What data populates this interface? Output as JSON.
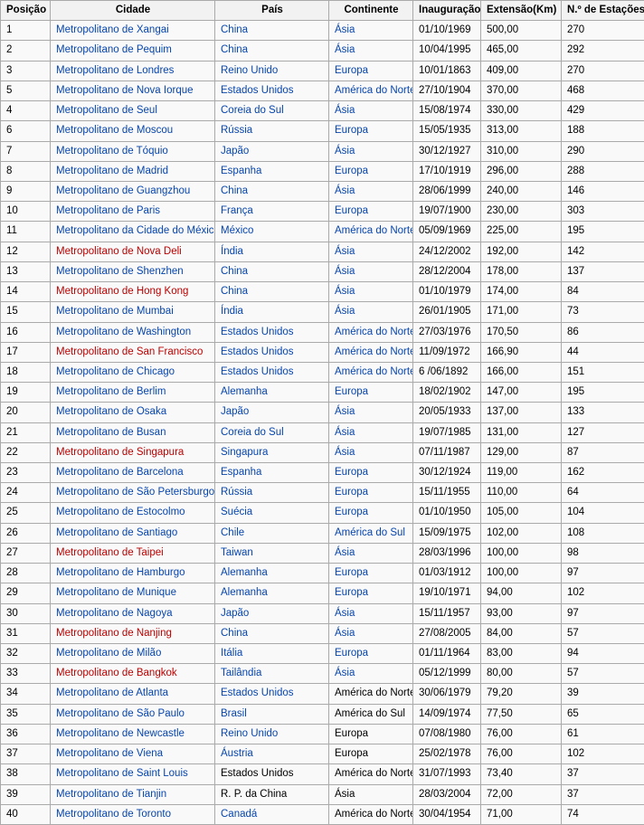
{
  "table": {
    "columns": [
      {
        "key": "posicao",
        "label": "Posição"
      },
      {
        "key": "cidade",
        "label": "Cidade"
      },
      {
        "key": "pais",
        "label": "País"
      },
      {
        "key": "continente",
        "label": "Continente"
      },
      {
        "key": "inauguracao",
        "label": "Inauguração"
      },
      {
        "key": "extensao",
        "label": "Extensão(Km)"
      },
      {
        "key": "estacoes",
        "label": "N.º de Estações"
      }
    ],
    "colors": {
      "link_blue": "#0645ad",
      "link_red": "#ba0000",
      "plain_text": "#000000",
      "header_bg": "#f2f2f2",
      "cell_bg": "#f9f9f9",
      "border": "#aaaaaa"
    },
    "rows": [
      {
        "posicao": "1",
        "cidade": "Metropolitano de Xangai",
        "cidade_style": "link-blue",
        "pais": "China",
        "pais_style": "link-blue",
        "continente": "Ásia",
        "continente_style": "link-blue",
        "inauguracao": "01/10/1969",
        "extensao": "500,00",
        "estacoes": "270"
      },
      {
        "posicao": "2",
        "cidade": "Metropolitano de Pequim",
        "cidade_style": "link-blue",
        "pais": "China",
        "pais_style": "link-blue",
        "continente": "Ásia",
        "continente_style": "link-blue",
        "inauguracao": "10/04/1995",
        "extensao": "465,00",
        "estacoes": "292"
      },
      {
        "posicao": "3",
        "cidade": "Metropolitano de Londres",
        "cidade_style": "link-blue",
        "pais": "Reino Unido",
        "pais_style": "link-blue",
        "continente": "Europa",
        "continente_style": "link-blue",
        "inauguracao": "10/01/1863",
        "extensao": "409,00",
        "estacoes": "270"
      },
      {
        "posicao": "5",
        "cidade": "Metropolitano de Nova Iorque",
        "cidade_style": "link-blue",
        "pais": "Estados Unidos",
        "pais_style": "link-blue",
        "continente": "América do Norte",
        "continente_style": "link-blue",
        "inauguracao": "27/10/1904",
        "extensao": "370,00",
        "estacoes": "468"
      },
      {
        "posicao": "4",
        "cidade": "Metropolitano de Seul",
        "cidade_style": "link-blue",
        "pais": "Coreia do Sul",
        "pais_style": "link-blue",
        "continente": "Ásia",
        "continente_style": "link-blue",
        "inauguracao": "15/08/1974",
        "extensao": "330,00",
        "estacoes": "429"
      },
      {
        "posicao": "6",
        "cidade": "Metropolitano de Moscou",
        "cidade_style": "link-blue",
        "pais": "Rússia",
        "pais_style": "link-blue",
        "continente": "Europa",
        "continente_style": "link-blue",
        "inauguracao": "15/05/1935",
        "extensao": "313,00",
        "estacoes": "188"
      },
      {
        "posicao": "7",
        "cidade": "Metropolitano de Tóquio",
        "cidade_style": "link-blue",
        "pais": "Japão",
        "pais_style": "link-blue",
        "continente": "Ásia",
        "continente_style": "link-blue",
        "inauguracao": "30/12/1927",
        "extensao": "310,00",
        "estacoes": "290"
      },
      {
        "posicao": "8",
        "cidade": "Metropolitano de Madrid",
        "cidade_style": "link-blue",
        "pais": "Espanha",
        "pais_style": "link-blue",
        "continente": "Europa",
        "continente_style": "link-blue",
        "inauguracao": "17/10/1919",
        "extensao": "296,00",
        "estacoes": "288"
      },
      {
        "posicao": "9",
        "cidade": "Metropolitano de Guangzhou",
        "cidade_style": "link-blue",
        "pais": "China",
        "pais_style": "link-blue",
        "continente": "Ásia",
        "continente_style": "link-blue",
        "inauguracao": "28/06/1999",
        "extensao": "240,00",
        "estacoes": "146"
      },
      {
        "posicao": "10",
        "cidade": "Metropolitano de Paris",
        "cidade_style": "link-blue",
        "pais": "França",
        "pais_style": "link-blue",
        "continente": "Europa",
        "continente_style": "link-blue",
        "inauguracao": "19/07/1900",
        "extensao": "230,00",
        "estacoes": "303"
      },
      {
        "posicao": "11",
        "cidade": "Metropolitano da Cidade do México",
        "cidade_style": "link-blue",
        "pais": "México",
        "pais_style": "link-blue",
        "continente": "América do Norte",
        "continente_style": "link-blue",
        "inauguracao": "05/09/1969",
        "extensao": "225,00",
        "estacoes": "195"
      },
      {
        "posicao": "12",
        "cidade": "Metropolitano de Nova Deli",
        "cidade_style": "link-red",
        "pais": "Índia",
        "pais_style": "link-blue",
        "continente": "Ásia",
        "continente_style": "link-blue",
        "inauguracao": "24/12/2002",
        "extensao": "192,00",
        "estacoes": "142"
      },
      {
        "posicao": "13",
        "cidade": "Metropolitano de Shenzhen",
        "cidade_style": "link-blue",
        "pais": "China",
        "pais_style": "link-blue",
        "continente": "Ásia",
        "continente_style": "link-blue",
        "inauguracao": "28/12/2004",
        "extensao": "178,00",
        "estacoes": "137"
      },
      {
        "posicao": "14",
        "cidade": "Metropolitano de Hong Kong",
        "cidade_style": "link-red",
        "pais": "China",
        "pais_style": "link-blue",
        "continente": "Ásia",
        "continente_style": "link-blue",
        "inauguracao": "01/10/1979",
        "extensao": "174,00",
        "estacoes": "84"
      },
      {
        "posicao": "15",
        "cidade": "Metropolitano de Mumbai",
        "cidade_style": "link-blue",
        "pais": "Índia",
        "pais_style": "link-blue",
        "continente": "Ásia",
        "continente_style": "link-blue",
        "inauguracao": "26/01/1905",
        "extensao": "171,00",
        "estacoes": "73"
      },
      {
        "posicao": "16",
        "cidade": "Metropolitano de Washington",
        "cidade_style": "link-blue",
        "pais": "Estados Unidos",
        "pais_style": "link-blue",
        "continente": "América do Norte",
        "continente_style": "link-blue",
        "inauguracao": "27/03/1976",
        "extensao": "170,50",
        "estacoes": "86"
      },
      {
        "posicao": "17",
        "cidade": "Metropolitano de San Francisco",
        "cidade_style": "link-red",
        "pais": "Estados Unidos",
        "pais_style": "link-blue",
        "continente": "América do Norte",
        "continente_style": "link-blue",
        "inauguracao": "11/09/1972",
        "extensao": "166,90",
        "estacoes": "44"
      },
      {
        "posicao": "18",
        "cidade": "Metropolitano de Chicago",
        "cidade_style": "link-blue",
        "pais": "Estados Unidos",
        "pais_style": "link-blue",
        "continente": "América do Norte",
        "continente_style": "link-blue",
        "inauguracao": "6 /06/1892",
        "extensao": "166,00",
        "estacoes": "151"
      },
      {
        "posicao": "19",
        "cidade": "Metropolitano de Berlim",
        "cidade_style": "link-blue",
        "pais": "Alemanha",
        "pais_style": "link-blue",
        "continente": "Europa",
        "continente_style": "link-blue",
        "inauguracao": "18/02/1902",
        "extensao": "147,00",
        "estacoes": "195"
      },
      {
        "posicao": "20",
        "cidade": "Metropolitano de Osaka",
        "cidade_style": "link-blue",
        "pais": "Japão",
        "pais_style": "link-blue",
        "continente": "Ásia",
        "continente_style": "link-blue",
        "inauguracao": "20/05/1933",
        "extensao": "137,00",
        "estacoes": "133"
      },
      {
        "posicao": "21",
        "cidade": "Metropolitano de Busan",
        "cidade_style": "link-blue",
        "pais": "Coreia do Sul",
        "pais_style": "link-blue",
        "continente": "Ásia",
        "continente_style": "link-blue",
        "inauguracao": "19/07/1985",
        "extensao": "131,00",
        "estacoes": "127"
      },
      {
        "posicao": "22",
        "cidade": "Metropolitano de Singapura",
        "cidade_style": "link-red",
        "pais": "Singapura",
        "pais_style": "link-blue",
        "continente": "Ásia",
        "continente_style": "link-blue",
        "inauguracao": "07/11/1987",
        "extensao": "129,00",
        "estacoes": "87"
      },
      {
        "posicao": "23",
        "cidade": "Metropolitano de Barcelona",
        "cidade_style": "link-blue",
        "pais": "Espanha",
        "pais_style": "link-blue",
        "continente": "Europa",
        "continente_style": "link-blue",
        "inauguracao": "30/12/1924",
        "extensao": "119,00",
        "estacoes": "162"
      },
      {
        "posicao": "24",
        "cidade": "Metropolitano de São Petersburgo",
        "cidade_style": "link-blue",
        "pais": "Rússia",
        "pais_style": "link-blue",
        "continente": "Europa",
        "continente_style": "link-blue",
        "inauguracao": "15/11/1955",
        "extensao": "110,00",
        "estacoes": "64"
      },
      {
        "posicao": "25",
        "cidade": "Metropolitano de Estocolmo",
        "cidade_style": "link-blue",
        "pais": "Suécia",
        "pais_style": "link-blue",
        "continente": "Europa",
        "continente_style": "link-blue",
        "inauguracao": "01/10/1950",
        "extensao": "105,00",
        "estacoes": "104"
      },
      {
        "posicao": "26",
        "cidade": "Metropolitano de Santiago",
        "cidade_style": "link-blue",
        "pais": "Chile",
        "pais_style": "link-blue",
        "continente": "América do Sul",
        "continente_style": "link-blue",
        "inauguracao": "15/09/1975",
        "extensao": "102,00",
        "estacoes": "108"
      },
      {
        "posicao": "27",
        "cidade": "Metropolitano de Taipei",
        "cidade_style": "link-red",
        "pais": "Taiwan",
        "pais_style": "link-blue",
        "continente": "Ásia",
        "continente_style": "link-blue",
        "inauguracao": "28/03/1996",
        "extensao": "100,00",
        "estacoes": "98"
      },
      {
        "posicao": "28",
        "cidade": "Metropolitano de Hamburgo",
        "cidade_style": "link-blue",
        "pais": "Alemanha",
        "pais_style": "link-blue",
        "continente": "Europa",
        "continente_style": "link-blue",
        "inauguracao": "01/03/1912",
        "extensao": "100,00",
        "estacoes": "97"
      },
      {
        "posicao": "29",
        "cidade": "Metropolitano de Munique",
        "cidade_style": "link-blue",
        "pais": "Alemanha",
        "pais_style": "link-blue",
        "continente": "Europa",
        "continente_style": "link-blue",
        "inauguracao": "19/10/1971",
        "extensao": "94,00",
        "estacoes": "102"
      },
      {
        "posicao": "30",
        "cidade": "Metropolitano de Nagoya",
        "cidade_style": "link-blue",
        "pais": "Japão",
        "pais_style": "link-blue",
        "continente": "Ásia",
        "continente_style": "link-blue",
        "inauguracao": "15/11/1957",
        "extensao": "93,00",
        "estacoes": "97"
      },
      {
        "posicao": "31",
        "cidade": "Metropolitano de Nanjing",
        "cidade_style": "link-red",
        "pais": "China",
        "pais_style": "link-blue",
        "continente": "Ásia",
        "continente_style": "link-blue",
        "inauguracao": "27/08/2005",
        "extensao": "84,00",
        "estacoes": "57"
      },
      {
        "posicao": "32",
        "cidade": "Metropolitano de Milão",
        "cidade_style": "link-blue",
        "pais": "Itália",
        "pais_style": "link-blue",
        "continente": "Europa",
        "continente_style": "link-blue",
        "inauguracao": "01/11/1964",
        "extensao": "83,00",
        "estacoes": "94"
      },
      {
        "posicao": "33",
        "cidade": "Metropolitano de Bangkok",
        "cidade_style": "link-red",
        "pais": "Tailândia",
        "pais_style": "link-blue",
        "continente": "Ásia",
        "continente_style": "link-blue",
        "inauguracao": "05/12/1999",
        "extensao": "80,00",
        "estacoes": "57"
      },
      {
        "posicao": "34",
        "cidade": "Metropolitano de Atlanta",
        "cidade_style": "link-blue",
        "pais": "Estados Unidos",
        "pais_style": "link-blue",
        "continente": "América do Norte",
        "continente_style": "plain",
        "inauguracao": "30/06/1979",
        "extensao": "79,20",
        "estacoes": "39"
      },
      {
        "posicao": "35",
        "cidade": "Metropolitano de São Paulo",
        "cidade_style": "link-blue",
        "pais": "Brasil",
        "pais_style": "link-blue",
        "continente": "América do Sul",
        "continente_style": "plain",
        "inauguracao": "14/09/1974",
        "extensao": "77,50",
        "estacoes": "65"
      },
      {
        "posicao": "36",
        "cidade": "Metropolitano de Newcastle",
        "cidade_style": "link-blue",
        "pais": "Reino Unido",
        "pais_style": "link-blue",
        "continente": "Europa",
        "continente_style": "plain",
        "inauguracao": "07/08/1980",
        "extensao": "76,00",
        "estacoes": "61"
      },
      {
        "posicao": "37",
        "cidade": "Metropolitano de Viena",
        "cidade_style": "link-blue",
        "pais": "Áustria",
        "pais_style": "link-blue",
        "continente": "Europa",
        "continente_style": "plain",
        "inauguracao": "25/02/1978",
        "extensao": "76,00",
        "estacoes": "102"
      },
      {
        "posicao": "38",
        "cidade": "Metropolitano de Saint Louis",
        "cidade_style": "link-blue",
        "pais": "Estados Unidos",
        "pais_style": "plain",
        "continente": "América do Norte",
        "continente_style": "plain",
        "inauguracao": "31/07/1993",
        "extensao": "73,40",
        "estacoes": "37"
      },
      {
        "posicao": "39",
        "cidade": "Metropolitano de Tianjin",
        "cidade_style": "link-blue",
        "pais": "R. P. da China",
        "pais_style": "plain",
        "continente": "Ásia",
        "continente_style": "plain",
        "inauguracao": "28/03/2004",
        "extensao": "72,00",
        "estacoes": "37"
      },
      {
        "posicao": "40",
        "cidade": "Metropolitano de Toronto",
        "cidade_style": "link-blue",
        "pais": "Canadá",
        "pais_style": "link-blue",
        "continente": "América do Norte",
        "continente_style": "plain",
        "inauguracao": "30/04/1954",
        "extensao": "71,00",
        "estacoes": "74"
      }
    ]
  }
}
